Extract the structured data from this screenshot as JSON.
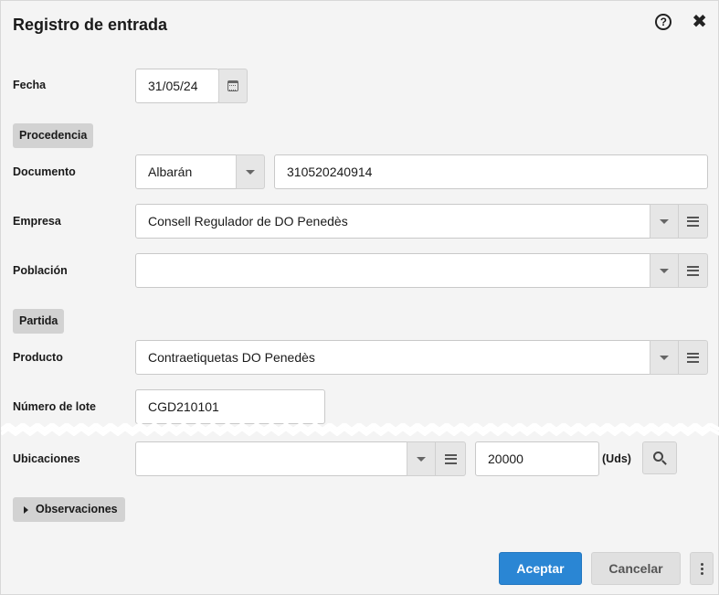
{
  "dialog": {
    "title": "Registro de entrada",
    "icons": [
      "help-icon",
      "close-icon"
    ]
  },
  "fecha": {
    "label": "Fecha",
    "value": "31/05/24"
  },
  "sections": {
    "procedencia": "Procedencia",
    "partida": "Partida"
  },
  "documento": {
    "label": "Documento",
    "type_value": "Albarán",
    "number_value": "310520240914"
  },
  "empresa": {
    "label": "Empresa",
    "value": "Consell Regulador de DO Penedès"
  },
  "poblacion": {
    "label": "Población",
    "value": ""
  },
  "producto": {
    "label": "Producto",
    "value": "Contraetiquetas DO Penedès"
  },
  "lote": {
    "label": "Número de lote",
    "value": "CGD210101"
  },
  "ubicaciones": {
    "label": "Ubicaciones",
    "value": "",
    "quantity": "20000",
    "unit": "(Uds)"
  },
  "observaciones": {
    "label": "Observaciones"
  },
  "buttons": {
    "accept": "Aceptar",
    "cancel": "Cancelar"
  },
  "colors": {
    "primary": "#2a86d4",
    "background": "#f4f4f4",
    "section": "#d2d2d2"
  }
}
